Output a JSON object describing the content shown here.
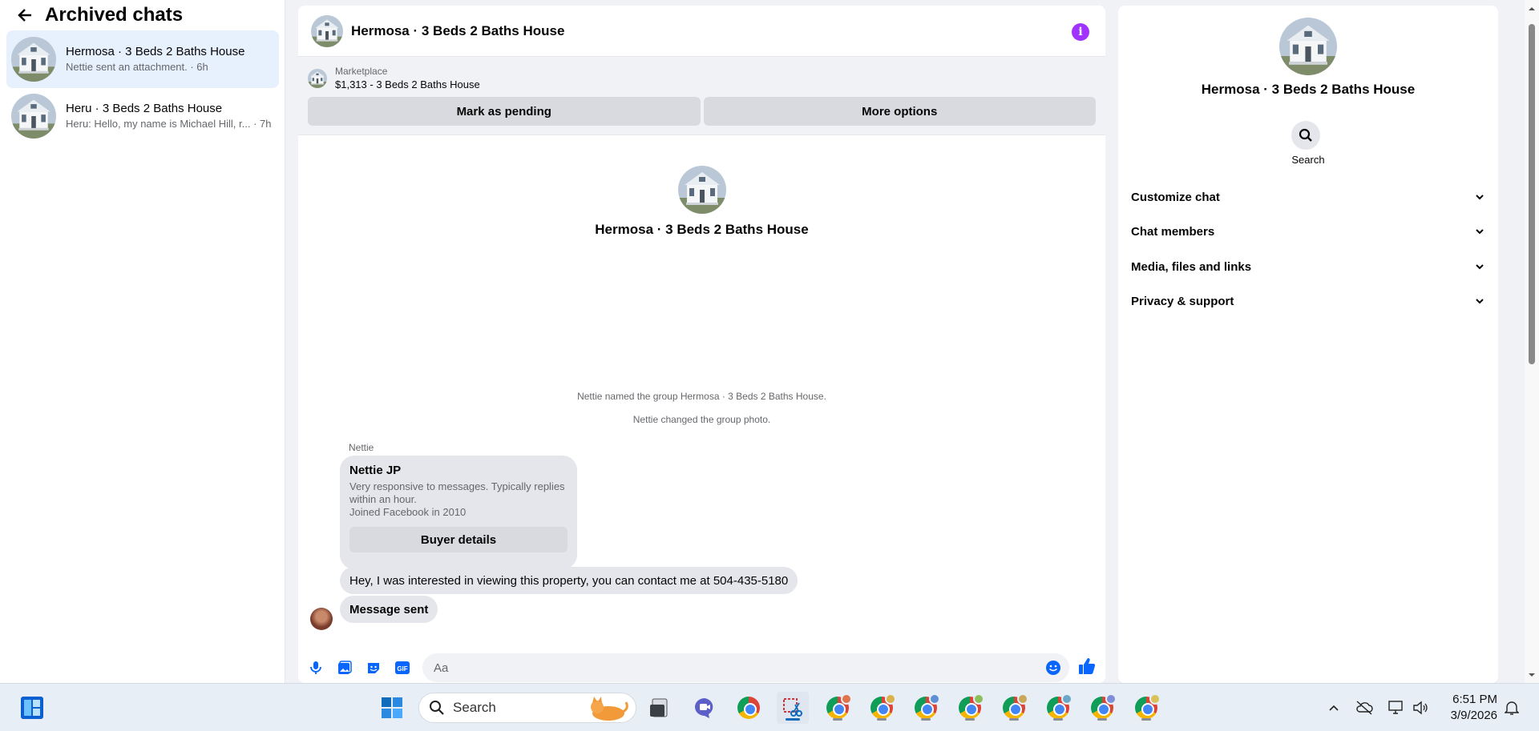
{
  "sidebar": {
    "title": "Archived chats",
    "chats": [
      {
        "name": "Hermosa · 3 Beds 2 Baths House",
        "preview": "Nettie sent an attachment. · 6h"
      },
      {
        "name": "Heru · 3 Beds 2 Baths House",
        "preview": "Heru: Hello, my name is Michael Hill, r... · 7h"
      }
    ]
  },
  "conversation": {
    "title": "Hermosa · 3 Beds 2 Baths House",
    "marketplace": {
      "label": "Marketplace",
      "listing": "$1,313 - 3 Beds 2 Baths House"
    },
    "actions": {
      "pending": "Mark as pending",
      "more": "More options"
    },
    "intro_title": "Hermosa · 3 Beds 2 Baths House",
    "system_messages": [
      "Nettie named the group Hermosa · 3 Beds 2 Baths House.",
      "Nettie changed the group photo."
    ],
    "sender": "Nettie",
    "profile_card": {
      "name": "Nettie JP",
      "desc_line1": "Very responsive to messages. Typically replies within an hour.",
      "desc_line2": "Joined Facebook in 2010",
      "button": "Buyer details"
    },
    "message": "Hey, I was interested in viewing this property, you can contact me at 504-435-5180",
    "status": "Message sent",
    "composer_placeholder": "Aa"
  },
  "details": {
    "title": "Hermosa · 3 Beds 2 Baths House",
    "search_label": "Search",
    "sections": [
      "Customize chat",
      "Chat members",
      "Media, files and links",
      "Privacy & support"
    ]
  },
  "taskbar": {
    "search_placeholder": "Search",
    "time": "6:51 PM",
    "date": "3/9/2026"
  },
  "colors": {
    "accent": "#0866ff",
    "info": "#a033ff",
    "active_chat": "#e7f0fd"
  }
}
